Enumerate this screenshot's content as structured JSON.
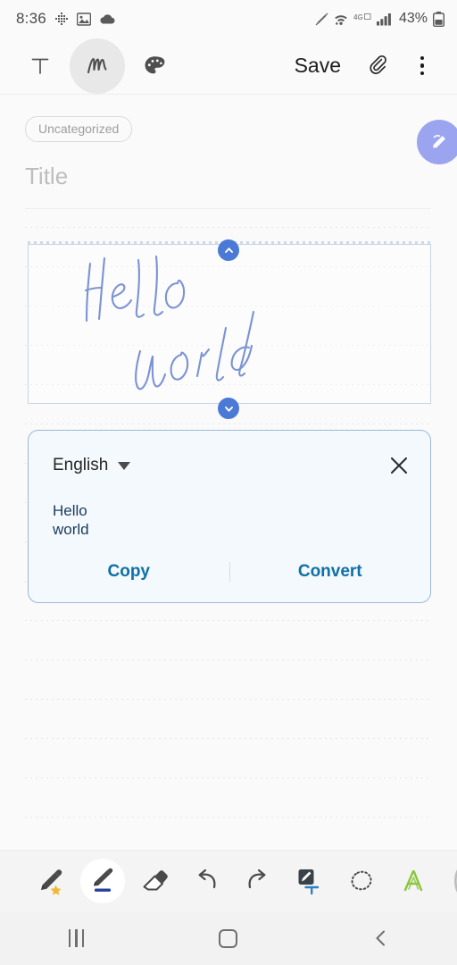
{
  "status_bar": {
    "time": "8:36",
    "left_icons": [
      "move-crosshair-icon",
      "image-icon",
      "cloud-icon"
    ],
    "right_icons": [
      "dnd-pen-icon",
      "wifi-icon",
      "4g-lte-icon",
      "signal-bars-icon"
    ],
    "network_label": "4G",
    "battery_percent": "43%"
  },
  "top_toolbar": {
    "text_mode_name": "text-mode",
    "handwriting_mode_name": "handwriting-mode",
    "palette_name": "color-palette",
    "save_label": "Save",
    "attach_name": "attachment",
    "more_name": "more-options"
  },
  "note": {
    "category_chip": "Uncategorized",
    "title_placeholder": "Title",
    "title_value": "",
    "fab_name": "edit-pen-fab",
    "handwriting_content": "Hello world",
    "selection": {
      "handle_up": "expand-up-handle",
      "handle_down": "expand-down-handle"
    }
  },
  "recognition_panel": {
    "language": "English",
    "recognized_text": "Hello\nworld",
    "copy_label": "Copy",
    "convert_label": "Convert",
    "close_name": "close-panel"
  },
  "pen_toolbar": {
    "tools": [
      {
        "name": "ai-pen-tool",
        "label": "AI Pen",
        "active": false
      },
      {
        "name": "pen-tool",
        "label": "Pen",
        "active": true
      },
      {
        "name": "eraser-tool",
        "label": "Eraser",
        "active": false
      },
      {
        "name": "undo-button",
        "label": "Undo",
        "active": false
      },
      {
        "name": "redo-button",
        "label": "Redo",
        "active": false
      },
      {
        "name": "text-conversion-tool",
        "label": "Convert to text",
        "active": false
      },
      {
        "name": "lasso-select-tool",
        "label": "Selection",
        "active": false
      },
      {
        "name": "highlighter-tool",
        "label": "Highlighter",
        "active": false
      },
      {
        "name": "more-tools",
        "label": "More",
        "active": false
      }
    ]
  },
  "nav_bar": {
    "recents_label": "Recents",
    "home_label": "Home",
    "back_label": "Back"
  },
  "colors": {
    "accent_blue": "#4a7ad6",
    "ink_blue": "#7b93d4",
    "panel_border": "#9cb8d6",
    "panel_bg": "#f3f9fc",
    "action_blue": "#0f6fa8",
    "fab_purple": "#9aa4ef"
  }
}
